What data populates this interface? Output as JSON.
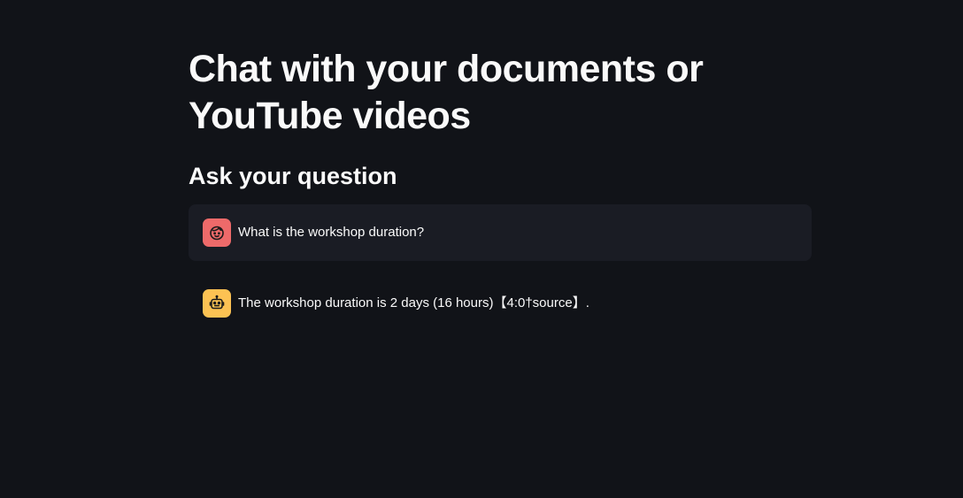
{
  "page": {
    "title": "Chat with your documents or YouTube videos",
    "section_heading": "Ask your question"
  },
  "chat": {
    "messages": [
      {
        "role": "user",
        "avatar_icon": "user-face-icon",
        "avatar_color": "#ee6a6a",
        "text": "What is the workshop duration?"
      },
      {
        "role": "assistant",
        "avatar_icon": "robot-icon",
        "avatar_color": "#fcc253",
        "text": "The workshop duration is 2 days (16 hours)【4:0†source】."
      }
    ]
  },
  "colors": {
    "background": "#111318",
    "user_message_background": "#1a1c24",
    "text": "#fafafa"
  }
}
